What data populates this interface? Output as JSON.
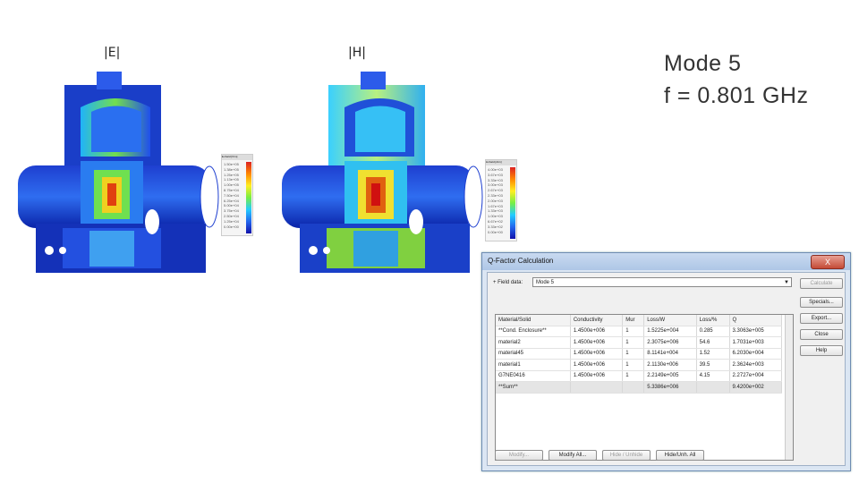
{
  "labels": {
    "e_field": "|E|",
    "h_field": "|H|"
  },
  "mode": {
    "line1": "Mode  5",
    "line2": "f = 0.801 GHz"
  },
  "legend_e": {
    "title": "E-Field [V/m]",
    "ticks": [
      "1.50e+05",
      "1.38e+05",
      "1.25e+05",
      "1.13e+05",
      "1.00e+05",
      "8.75e+04",
      "7.50e+04",
      "6.25e+04",
      "5.00e+04",
      "3.75e+04",
      "2.50e+04",
      "1.25e+04",
      "0.00e+00"
    ]
  },
  "legend_h": {
    "title": "H-Field [A/m]",
    "ticks": [
      "4.00e+03",
      "3.67e+03",
      "3.33e+03",
      "3.00e+03",
      "2.67e+03",
      "2.33e+03",
      "2.00e+03",
      "1.67e+03",
      "1.33e+03",
      "1.00e+03",
      "6.67e+02",
      "3.33e+02",
      "0.00e+00"
    ]
  },
  "colors": {
    "dialog_title_bg": "#aec6e6",
    "close_red": "#c44a36"
  },
  "dialog": {
    "title": "Q-Factor Calculation",
    "close_label": "X",
    "field_data_label": "+ Field data:",
    "field_data_value": "Mode 5",
    "columns": [
      "Material/Solid",
      "Conductivity",
      "Mur",
      "Loss/W",
      "Loss/%",
      "Q"
    ],
    "rows": [
      [
        "**Cond. Enclosure**",
        "1.4500e+006",
        "1",
        "1.5225e+004",
        "0.285",
        "3.3063e+005"
      ],
      [
        "material2",
        "1.4500e+006",
        "1",
        "2.3075e+006",
        "54.6",
        "1.7031e+003"
      ],
      [
        "material45",
        "1.4500e+006",
        "1",
        "8.1141e+004",
        "1.52",
        "6.2030e+004"
      ],
      [
        "material1",
        "1.4500e+006",
        "1",
        "2.1130e+006",
        "39.5",
        "2.3624e+003"
      ],
      [
        "G7NE0416",
        "1.4500e+006",
        "1",
        "2.2149e+005",
        "4.15",
        "2.2727e+004"
      ],
      [
        "**Sum**",
        "",
        "",
        "5.3386e+006",
        "",
        "9.4200e+002"
      ]
    ],
    "side_buttons": [
      "Calculate",
      "Specials...",
      "Export...",
      "Close",
      "Help"
    ],
    "bottom_buttons": [
      "Modify...",
      "Modify All...",
      "Hide / Unhide",
      "Hide/Unh. All"
    ]
  }
}
